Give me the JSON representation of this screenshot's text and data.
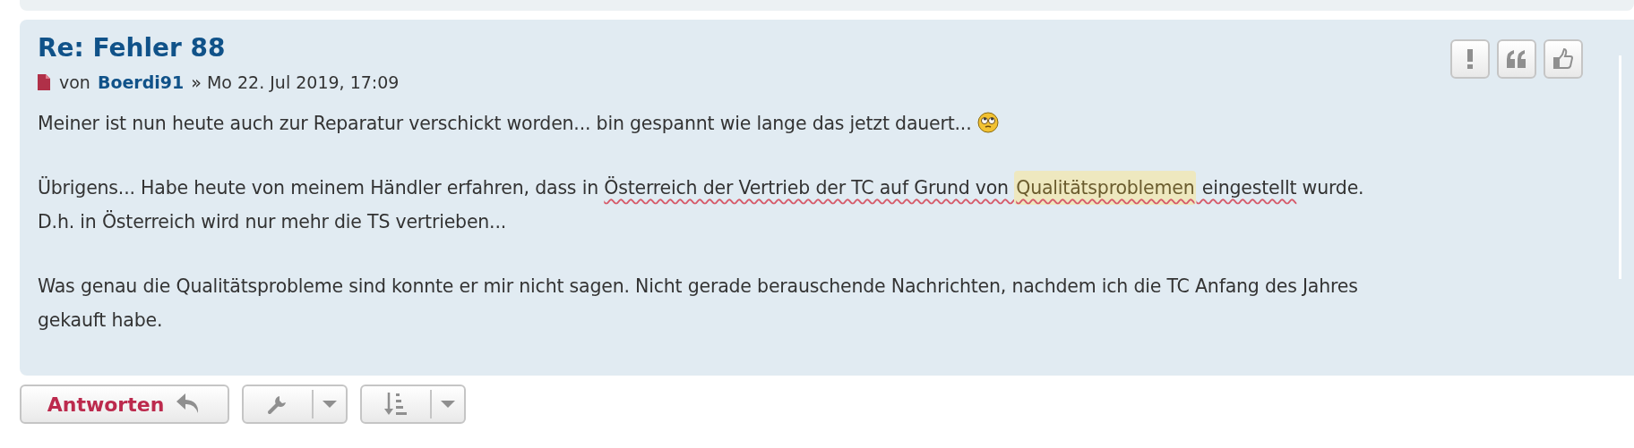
{
  "post": {
    "title": "Re: Fehler 88",
    "meta": {
      "prefix": "von",
      "author": "Boerdi91",
      "date": "» Mo 22. Jul 2019, 17:09"
    },
    "actions": [
      {
        "kind": "report"
      },
      {
        "kind": "quote"
      },
      {
        "kind": "like"
      }
    ],
    "paragraphs": [
      [
        {
          "text": "Meiner ist nun heute auch zur Reparatur verschickt worden... bin gespannt wie lange das jetzt dauert... "
        },
        {
          "kind": "emoji"
        }
      ],
      [
        {
          "text": "Übrigens... Habe heute von meinem Händler erfahren, dass in "
        },
        {
          "text": "Österreich der Vertrieb der TC auf Grund von ",
          "spellcheck": true
        },
        {
          "text": "Qualitätsproblemen",
          "spellcheck": true,
          "highlight": true
        },
        {
          "text": " eingestellt",
          "spellcheck": true
        },
        {
          "text": " wurde. D.h. in Österreich wird nur mehr die TS vertrieben..."
        }
      ],
      [
        {
          "text": "Was genau die Qualitätsprobleme sind konnte er mir nicht sagen. Nicht gerade berauschende Nachrichten, nachdem ich die TC Anfang des Jahres gekauft habe."
        }
      ]
    ]
  },
  "toolbar": {
    "reply": "Antworten",
    "tools": [
      {
        "kind": "tools"
      },
      {
        "kind": "sort"
      }
    ]
  }
}
